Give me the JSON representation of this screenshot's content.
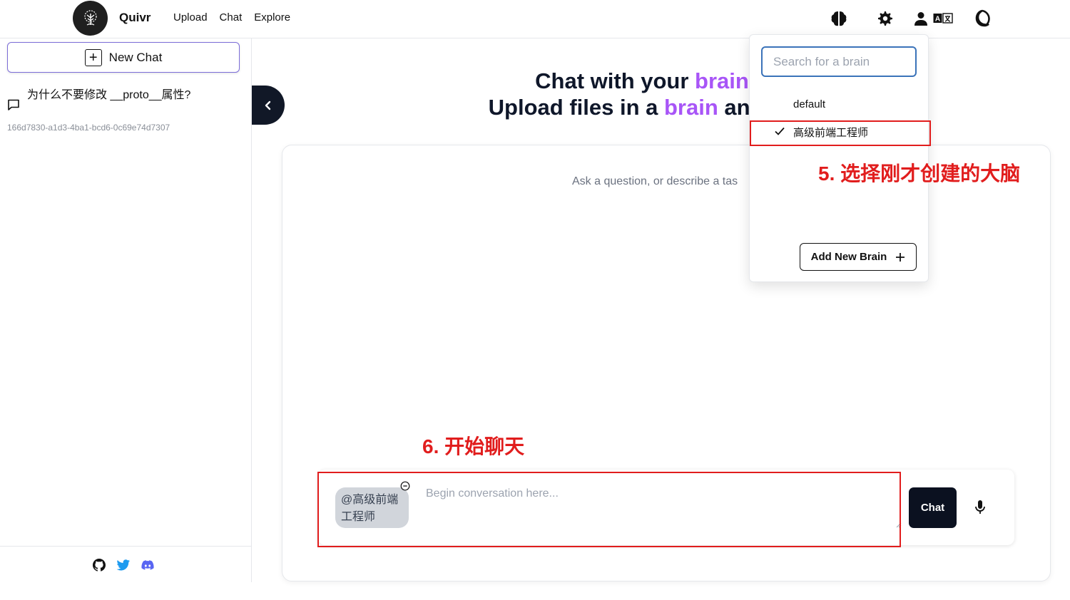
{
  "header": {
    "brand": "Quivr",
    "nav": [
      "Upload",
      "Chat",
      "Explore"
    ],
    "icons": [
      "brain-icon",
      "gear-icon",
      "user-icon",
      "language-icon",
      "moon-icon"
    ]
  },
  "sidebar": {
    "new_chat_label": "New Chat",
    "chats": [
      {
        "title": "为什么不要修改 __proto__属性?",
        "id": "166d7830-a1d3-4ba1-bcd6-0c69e74d7307"
      }
    ],
    "footer_icons": [
      "github-icon",
      "twitter-icon",
      "discord-icon"
    ]
  },
  "main": {
    "heading_line1_a": "Chat with your ",
    "heading_line1_b": "brain",
    "heading_line2_a": "Upload files in a ",
    "heading_line2_b": "brain",
    "heading_line2_c": " and ch",
    "ask_text": "Ask a question, or describe a tas",
    "brain_chip": "@高级前端工程师",
    "input_placeholder": "Begin conversation here...",
    "chat_button": "Chat"
  },
  "brain_dropdown": {
    "search_placeholder": "Search for a brain",
    "options": [
      {
        "label": "default",
        "selected": false
      },
      {
        "label": "高级前端工程师",
        "selected": true
      }
    ],
    "add_button": "Add New Brain"
  },
  "annotations": {
    "step5": "5. 选择刚才创建的大脑",
    "step6": "6. 开始聊天",
    "color": "#e11d1d"
  },
  "colors": {
    "accent_purple": "#a855f7",
    "dark_button": "#0b1120",
    "search_border": "#3b73b9"
  }
}
